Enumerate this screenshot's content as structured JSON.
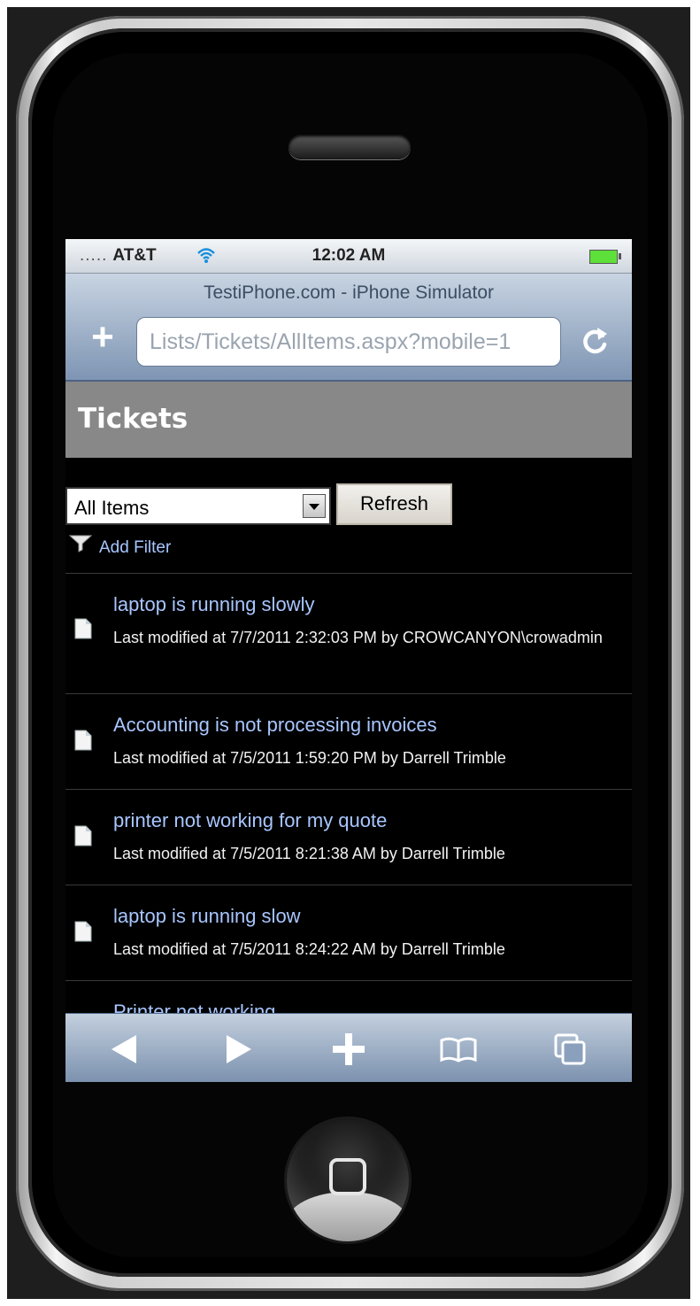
{
  "status_bar": {
    "carrier": "AT&T",
    "signal_dots": ".....",
    "time": "12:02 AM"
  },
  "browser": {
    "page_title": "TestiPhone.com - iPhone Simulator",
    "url": "Lists/Tickets/AllItems.aspx?mobile=1",
    "add_icon": "plus-icon",
    "reload_icon": "reload-icon"
  },
  "header": {
    "title": "Tickets"
  },
  "controls": {
    "view_selected": "All Items",
    "refresh_label": "Refresh",
    "add_filter_label": "Add Filter"
  },
  "items": [
    {
      "title": "laptop is running slowly",
      "meta": "Last modified at 7/7/2011 2:32:03 PM by CROWCANYON\\crowadmin"
    },
    {
      "title": "Accounting is not processing invoices",
      "meta": "Last modified at 7/5/2011 1:59:20 PM by Darrell Trimble"
    },
    {
      "title": "printer not working for my quote",
      "meta": "Last modified at 7/5/2011 8:21:38 AM by Darrell Trimble"
    },
    {
      "title": "laptop is running slow",
      "meta": "Last modified at 7/5/2011 8:24:22 AM by Darrell Trimble"
    },
    {
      "title": "Printer not working",
      "meta": ""
    }
  ],
  "toolbar": {
    "icons": [
      "back-icon",
      "forward-icon",
      "add-icon",
      "bookmarks-icon",
      "pages-icon"
    ]
  },
  "colors": {
    "link": "#a8c6ff",
    "header_bg": "#888888",
    "toolbar_top": "#c3cfde",
    "toolbar_bottom": "#7b91ae"
  }
}
